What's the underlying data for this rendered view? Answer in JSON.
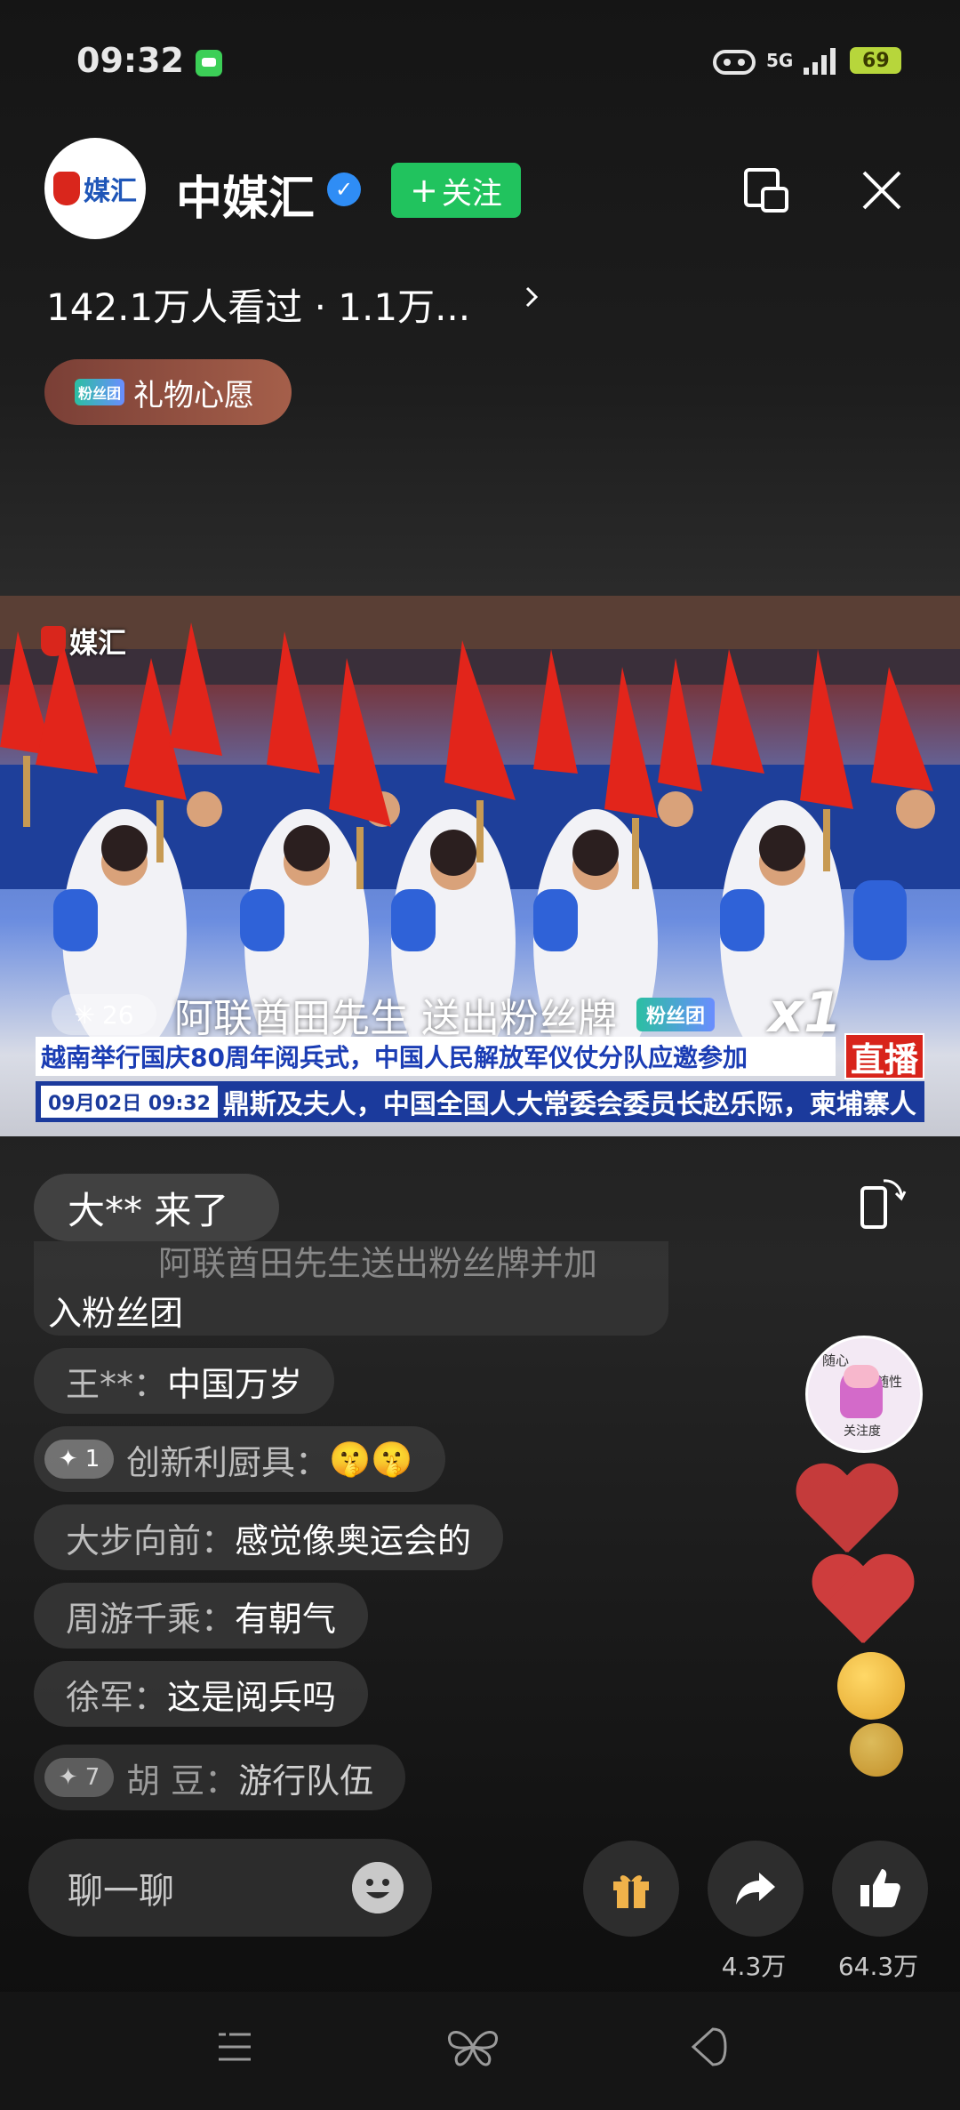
{
  "status_bar": {
    "time": "09:32",
    "network": "5G",
    "battery": "69"
  },
  "header": {
    "channel_name": "中媒汇",
    "follow_label": "关注",
    "avatar_logo_text": "媒汇",
    "stats_text": "142.1万人看过 · 1.1万...",
    "gift_wish_badge": "粉丝团",
    "gift_wish_label": "礼物心愿"
  },
  "video": {
    "watermark": "媒汇",
    "fan_notice": {
      "level": "26",
      "text": "阿联酋田先生 送出粉丝牌",
      "badge": "粉丝团",
      "multiplier": "x1"
    },
    "news_headline": "越南举行国庆80周年阅兵式，中国人民解放军仪仗分队应邀参加",
    "live_badge": "直播",
    "news_date": "09月02日 09:32",
    "news_ticker": "鼎斯及夫人，中国全国人大常委会委员长赵乐际，柬埔寨人"
  },
  "chat": {
    "join_notice": "大** 来了",
    "faded_top": "阿联酋田先生送出粉丝牌并加",
    "faded_bottom": "入粉丝团",
    "messages": [
      {
        "level": "",
        "name": "王**：",
        "text": "中国万岁"
      },
      {
        "level": "1",
        "name": "创新利厨具：",
        "text": "🤫🤫"
      },
      {
        "level": "",
        "name": "大步向前：",
        "text": "感觉像奥运会的"
      },
      {
        "level": "",
        "name": "周游千乘：",
        "text": "有朝气"
      },
      {
        "level": "",
        "name": "徐军：",
        "text": "这是阅兵吗"
      },
      {
        "level": "7",
        "name": "胡 豆：",
        "text": "游行队伍"
      }
    ]
  },
  "streamer_badge": {
    "top_left": "随心",
    "top_right": "随性",
    "bottom": "关注度"
  },
  "bottom_bar": {
    "chat_placeholder": "聊一聊",
    "share_count": "4.3万",
    "like_count": "64.3万"
  },
  "colors": {
    "follow": "#21c35e",
    "live": "#d8241b",
    "news_blue": "#1b3a9c",
    "verified": "#2f8df5"
  },
  "icons": [
    "message-icon",
    "wifi-icon",
    "signal-icon",
    "battery-icon",
    "verified-icon",
    "pip-icon",
    "close-icon",
    "chevron-right-icon",
    "rotate-screen-icon",
    "smile-icon",
    "gift-icon",
    "share-icon",
    "like-icon",
    "menu-icon",
    "butterfly-icon",
    "back-icon"
  ]
}
